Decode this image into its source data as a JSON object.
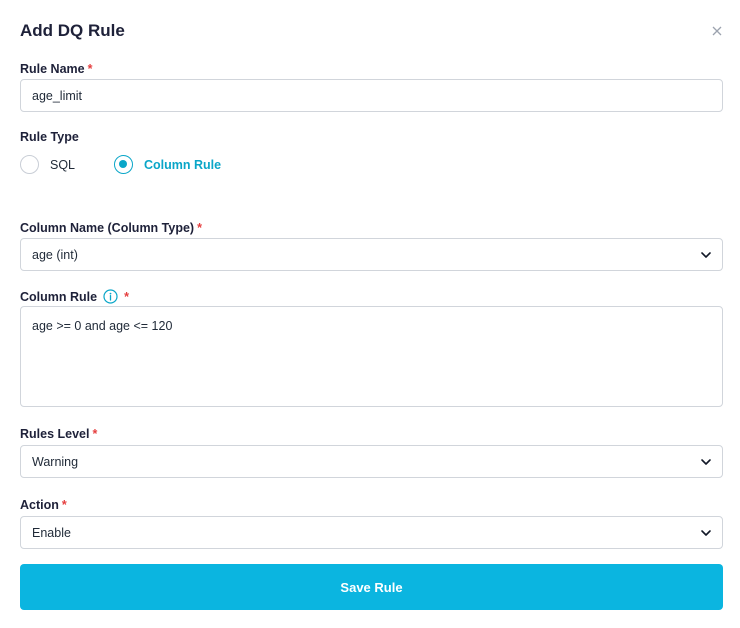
{
  "modal": {
    "title": "Add DQ Rule",
    "close_icon": "close-icon"
  },
  "rule_name": {
    "label": "Rule Name",
    "required": "*",
    "value": "age_limit"
  },
  "rule_type": {
    "label": "Rule Type",
    "options": [
      {
        "label": "SQL",
        "selected": false
      },
      {
        "label": "Column Rule",
        "selected": true
      }
    ]
  },
  "column_name": {
    "label": "Column Name (Column Type)",
    "required": "*",
    "value": "age (int)"
  },
  "column_rule": {
    "label": "Column Rule",
    "required": "*",
    "info_icon": "info-icon",
    "value": "age >= 0 and  age <= 120"
  },
  "rules_level": {
    "label": "Rules Level",
    "required": "*",
    "value": "Warning"
  },
  "action": {
    "label": "Action",
    "required": "*",
    "value": "Enable"
  },
  "save_button": {
    "label": "Save Rule"
  },
  "colors": {
    "accent": "#0aa6c8",
    "button": "#0bb5e0",
    "required": "#e53e3e",
    "heading": "#1e2139"
  }
}
